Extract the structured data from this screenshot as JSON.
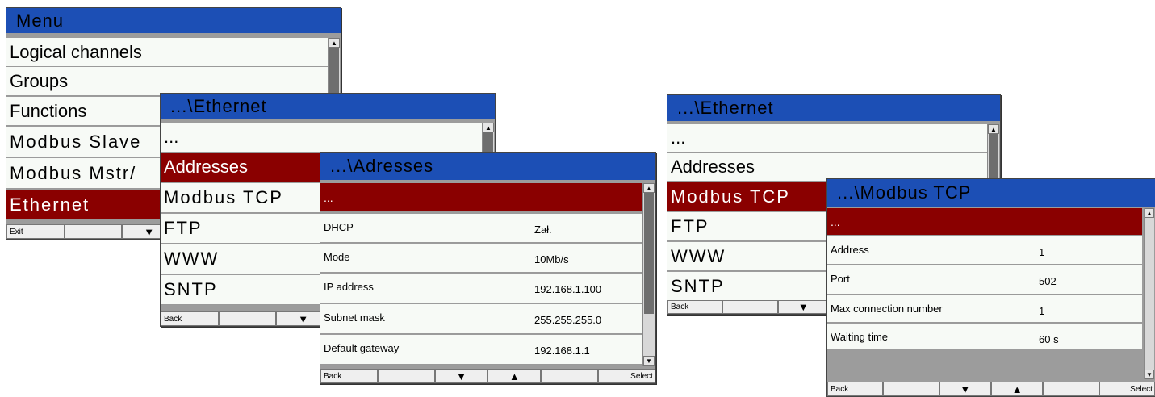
{
  "menu": {
    "title": "Menu",
    "items": [
      "Logical channels",
      "Groups",
      "Functions",
      "Modbus Slave",
      "Modbus Mstr/",
      "Ethernet"
    ],
    "fkeys": [
      "Exit",
      "",
      "▼"
    ]
  },
  "ethernet_left": {
    "title": "...\\Ethernet",
    "items": [
      "...",
      "Addresses",
      "Modbus TCP",
      "FTP",
      "WWW",
      "SNTP"
    ],
    "fkeys": [
      "Back",
      "",
      "▼"
    ]
  },
  "addresses": {
    "title": "...\\Adresses",
    "selected": "...",
    "rows": [
      {
        "label": "DHCP",
        "value": "Zał."
      },
      {
        "label": "Mode",
        "value": "10Mb/s"
      },
      {
        "label": "IP address",
        "value": "192.168.1.100"
      },
      {
        "label": "Subnet mask",
        "value": "255.255.255.0"
      },
      {
        "label": "Default gateway",
        "value": "192.168.1.1"
      }
    ],
    "fkeys": [
      "Back",
      "",
      "▼",
      "▲",
      "",
      "Select"
    ]
  },
  "ethernet_right": {
    "title": "...\\Ethernet",
    "items": [
      "...",
      "Addresses",
      "Modbus TCP",
      "FTP",
      "WWW",
      "SNTP"
    ],
    "fkeys": [
      "Back",
      "",
      "▼"
    ]
  },
  "modbus_tcp": {
    "title": "...\\Modbus TCP",
    "selected": "...",
    "rows": [
      {
        "label": "Address",
        "value": "1"
      },
      {
        "label": "Port",
        "value": "502"
      },
      {
        "label": "Max connection number",
        "value": "1"
      },
      {
        "label": "Waiting time",
        "value": "60 s"
      }
    ],
    "fkeys": [
      "Back",
      "",
      "▼",
      "▲",
      "",
      "Select"
    ]
  },
  "colors": {
    "title_bar": "#1c4fb5",
    "selected_row": "#8a0000",
    "row_bg": "#f7faf6"
  }
}
